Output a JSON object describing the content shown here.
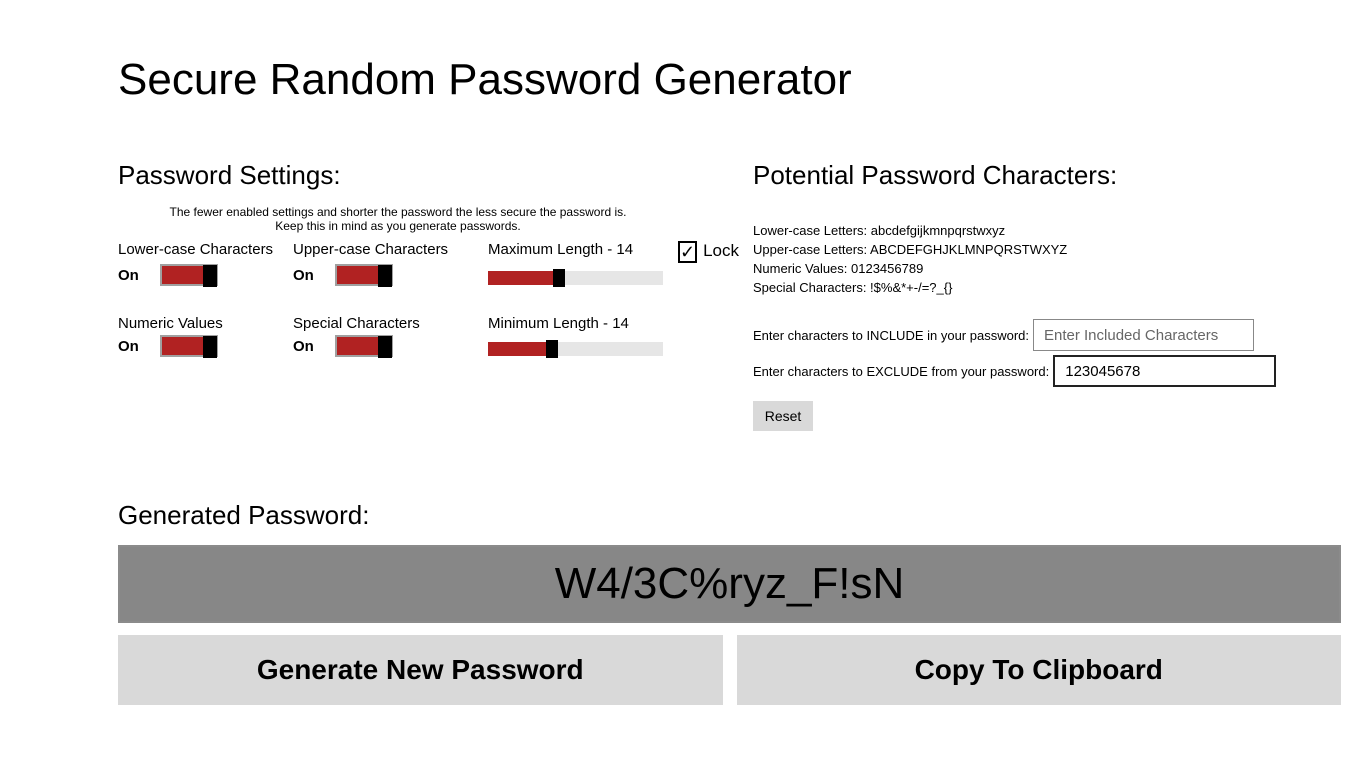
{
  "title": "Secure Random Password Generator",
  "settings": {
    "heading": "Password Settings:",
    "hint_line1": "The fewer enabled settings and shorter the password the less secure the password is.",
    "hint_line2": "Keep this in mind as you generate passwords.",
    "lowercase": {
      "label": "Lower-case Characters",
      "state": "On"
    },
    "uppercase": {
      "label": "Upper-case Characters",
      "state": "On"
    },
    "numeric": {
      "label": "Numeric Values",
      "state": "On"
    },
    "special": {
      "label": "Special Characters",
      "state": "On"
    },
    "max_length": {
      "label": "Maximum Length - 14",
      "value": 14,
      "fill_pct": 37
    },
    "min_length": {
      "label": "Minimum Length - 14",
      "value": 14,
      "fill_pct": 33
    },
    "lock": {
      "label": "Lock",
      "checked": true
    }
  },
  "potential": {
    "heading": "Potential Password Characters:",
    "lower": "Lower-case Letters: abcdefgijkmnpqrstwxyz",
    "upper": "Upper-case Letters: ABCDEFGHJKLMNPQRSTWXYZ",
    "numeric": "Numeric Values: 0123456789",
    "special": "Special Characters: !$%&*+-/=?_{}",
    "include_label": "Enter characters to INCLUDE in your password:",
    "include_placeholder": "Enter Included Characters",
    "include_value": "",
    "exclude_label": "Enter characters to EXCLUDE from your password:",
    "exclude_value": "123045678",
    "reset_label": "Reset"
  },
  "generated": {
    "heading": "Generated Password:",
    "password": "W4/3C%ryz_F!sN",
    "generate_label": "Generate New Password",
    "copy_label": "Copy To Clipboard"
  }
}
